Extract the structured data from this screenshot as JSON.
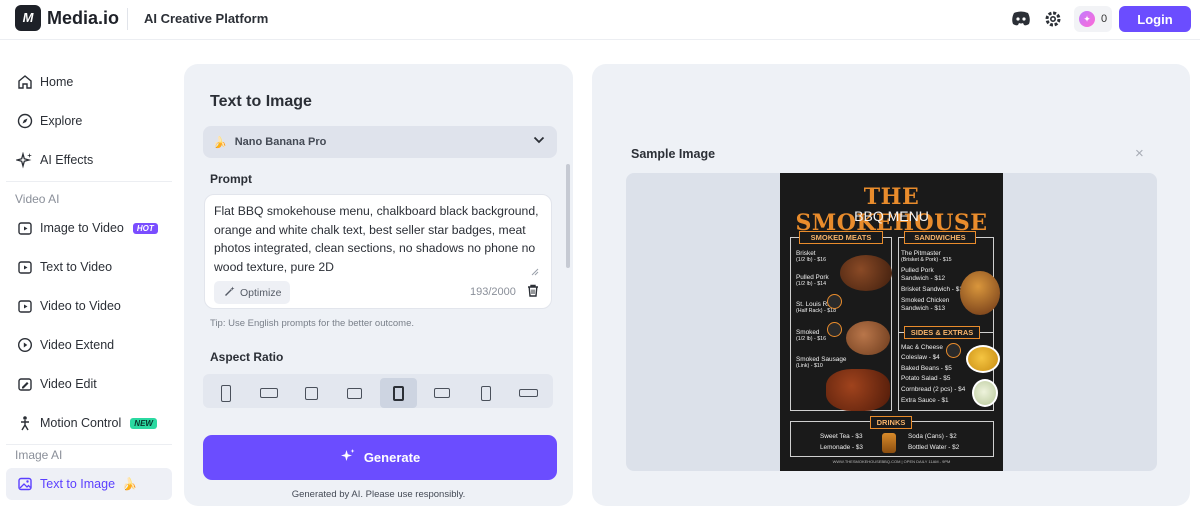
{
  "header": {
    "logo_mark": "M",
    "logo_text": "Media.io",
    "platform": "AI Creative Platform",
    "credits": "0",
    "login_label": "Login",
    "icons": [
      "discord-icon",
      "settings-gear-icon",
      "credits-icon"
    ]
  },
  "sidebar": {
    "items": [
      {
        "label": "Home",
        "icon": "home-icon"
      },
      {
        "label": "Explore",
        "icon": "compass-icon"
      },
      {
        "label": "AI Effects",
        "icon": "sparkle-icon"
      }
    ],
    "video_section": "Video AI",
    "video_items": [
      {
        "label": "Image to Video",
        "badge": "HOT"
      },
      {
        "label": "Text to Video"
      },
      {
        "label": "Video to Video"
      },
      {
        "label": "Video Extend"
      },
      {
        "label": "Video Edit"
      },
      {
        "label": "Motion Control",
        "badge": "NEW"
      }
    ],
    "image_section": "Image AI",
    "image_items": [
      {
        "label": "Text to Image",
        "active": true,
        "emoji": "🍌"
      }
    ]
  },
  "form": {
    "title": "Text to Image",
    "model": "Nano Banana Pro",
    "model_emoji": "🍌",
    "prompt_label": "Prompt",
    "prompt_text": "Flat BBQ smokehouse menu, chalkboard black background, orange and white chalk text, best seller star badges, meat photos integrated, clean sections, no shadows no phone no wood texture, pure 2D",
    "optimize_label": "Optimize",
    "char_count": "193/2000",
    "tip": "Tip: Use English prompts for the better outcome.",
    "aspect_label": "Aspect Ratio",
    "aspect_selected_index": 4,
    "generate_label": "Generate",
    "disclaimer": "Generated by AI. Please use responsibly."
  },
  "preview": {
    "label": "Sample Image",
    "close": "×",
    "menu": {
      "title": "THE SMOKEHOUSE",
      "subtitle": "BBQ MENU",
      "sec_meats": "SMOKED MEATS",
      "sec_sand": "SANDWICHES",
      "sec_sides": "SIDES & EXTRAS",
      "sec_drinks": "DRINKS",
      "meats": [
        "Brisket",
        "(1/2 lb) - $16",
        "Pulled Pork",
        "(1/2 lb) - $14",
        "St. Louis Ribs",
        "(Half Rack) - $18",
        "Smoked",
        "(1/2 lb) - $16",
        "Smoked Sausage",
        "(Link) - $10"
      ],
      "sandwiches": [
        "The Pitmaster",
        "(Brisket & Pork) - $15",
        "Pulled Pork",
        "Sandwich - $12",
        "Brisket Sandwich - $14",
        "Smoked Chicken",
        "Sandwich - $13"
      ],
      "sides": [
        "Mac & Cheese",
        "Coleslaw - $4",
        "Baked Beans - $5",
        "Potato Salad - $5",
        "Cornbread (2 pcs) - $4",
        "Extra Sauce - $1"
      ],
      "drinks_left": [
        "Sweet Tea - $3",
        "Lemonade - $3"
      ],
      "drinks_right": [
        "Soda (Cans) - $2",
        "Bottled Water - $2"
      ],
      "footer": "WWW.THESMOKEHOUSEBBQ.COM | OPEN DAILY 11AM - 9PM"
    }
  },
  "colors": {
    "accent": "#6b4dff",
    "panel_bg": "#eef1f6",
    "menu_orange": "#e98c2c"
  }
}
